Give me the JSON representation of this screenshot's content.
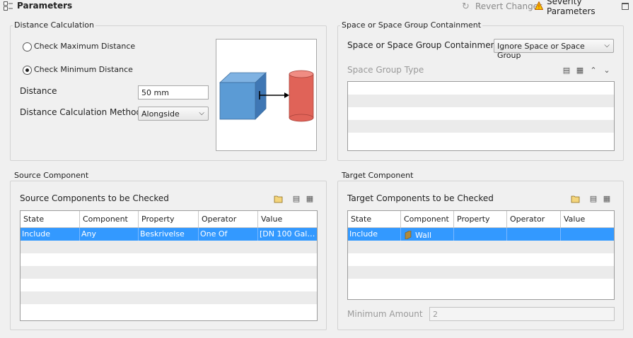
{
  "header": {
    "title": "Parameters",
    "revert_label": "Revert Changes",
    "severity_label": "Severity Parameters"
  },
  "distance_calc": {
    "legend": "Distance Calculation",
    "radio_max": "Check Maximum Distance",
    "radio_min": "Check Minimum Distance",
    "selected": "min",
    "distance_label": "Distance",
    "distance_value": "50 mm",
    "method_label": "Distance Calculation Method",
    "method_value": "Alongside"
  },
  "containment": {
    "legend": "Space or Space Group Containment",
    "label": "Space or Space Group Containment",
    "value": "Ignore Space or Space Group",
    "type_label": "Space Group Type"
  },
  "source": {
    "legend": "Source Component",
    "title": "Source Components to be Checked",
    "columns": [
      "State",
      "Component",
      "Property",
      "Operator",
      "Value"
    ],
    "rows": [
      [
        "Include",
        "Any",
        "Beskrivelse",
        "One Of",
        "[DN 100 Galv…"
      ]
    ]
  },
  "target": {
    "legend": "Target Component",
    "title": "Target Components to be Checked",
    "columns": [
      "State",
      "Component",
      "Property",
      "Operator",
      "Value"
    ],
    "rows": [
      [
        "Include",
        "Wall",
        "",
        "",
        ""
      ]
    ],
    "min_amount_label": "Minimum Amount",
    "min_amount_value": "2"
  },
  "colors": {
    "selection": "#3399ff",
    "cube": "#5b9bd5",
    "cylinder": "#e06358"
  }
}
